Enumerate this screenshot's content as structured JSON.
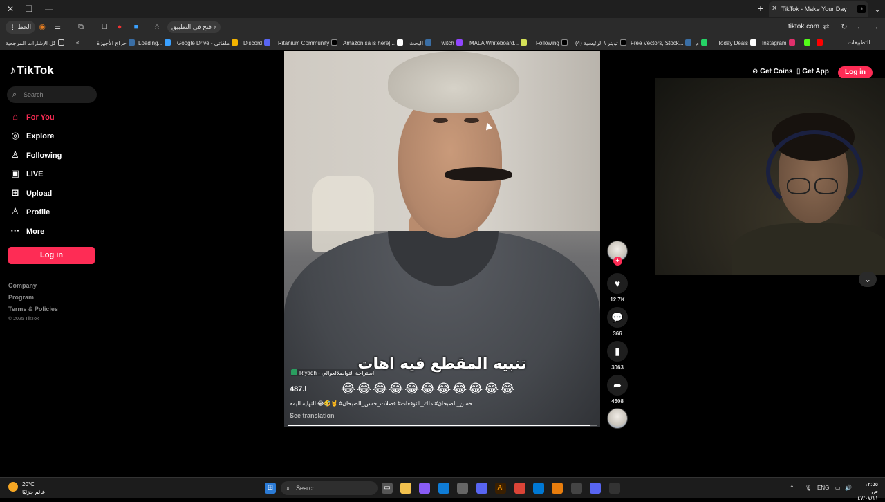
{
  "browser": {
    "tab_title": "TikTok - Make Your Day",
    "url": "tiktok.com",
    "menu_label": "الحظ",
    "open_in_app": "فتح في التطبيق",
    "bookmarks": [
      "كل الإشارات المرجعية",
      "حراج الأجهزة",
      "Loading...",
      "Google Drive - ملفاتي",
      "Discord",
      "Ritanium Community",
      "Amazon.sa is here|...",
      "البحث",
      "Twitch",
      "MALA Whiteboard...",
      "Following",
      "(4) تويتر \\ الرئيسية",
      "Free Vectors, Stock...",
      "م",
      "Today Deals",
      "Instagram",
      "التطبيقات"
    ]
  },
  "tiktok": {
    "logo": "TikTok",
    "search_placeholder": "Search",
    "nav": [
      {
        "label": "For You",
        "icon": "home-icon",
        "active": true
      },
      {
        "label": "Explore",
        "icon": "compass-icon",
        "active": false
      },
      {
        "label": "Following",
        "icon": "following-icon",
        "active": false
      },
      {
        "label": "LIVE",
        "icon": "live-icon",
        "active": false
      },
      {
        "label": "Upload",
        "icon": "upload-icon",
        "active": false
      },
      {
        "label": "Profile",
        "icon": "profile-icon",
        "active": false
      },
      {
        "label": "More",
        "icon": "more-icon",
        "active": false
      }
    ],
    "login_label": "Log in",
    "footer": {
      "company": "Company",
      "program": "Program",
      "terms": "Terms & Policies",
      "copyright": "© 2025 TikTok"
    },
    "top_links": {
      "get_coins": "Get Coins",
      "get_app": "Get App",
      "login": "Log in"
    },
    "video": {
      "caption_overlay": "تنبيه المقطع فيه اهات",
      "emoji_row": "😂😂😂😂😂😂😂😂😂😂😂",
      "location": "Riyadh - استراحة التواصلالعوالي",
      "author": "487.l",
      "description": "حسن_الصبحان# ملك_التوقعات# فصلات_حسن_الصبحان# 🤘🤣😂 النهايه اليمه",
      "see_translation": "See translation",
      "progress": 0.98
    },
    "actions": {
      "likes": "12.7K",
      "comments": "366",
      "saves": "3063",
      "shares": "4508"
    }
  },
  "taskbar": {
    "weather_temp": "20°C",
    "weather_desc": "غائم جزئيًا",
    "search_label": "Search",
    "lang": "ENG",
    "time": "١٢:٥٥ ص",
    "date": "٤٧/٠٧/١١"
  },
  "colors": {
    "accent": "#fe2c55",
    "background": "#000000"
  }
}
